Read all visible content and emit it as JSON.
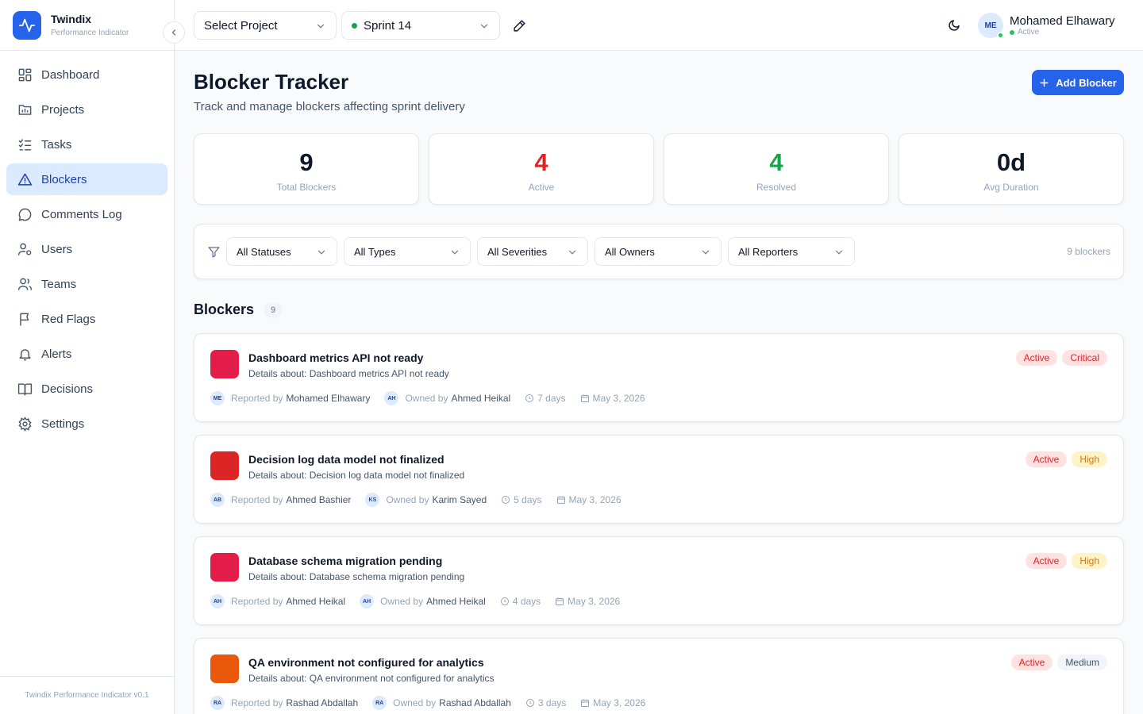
{
  "brand": {
    "name": "Twindix",
    "subtitle": "Performance Indicator"
  },
  "sidebar": {
    "items": [
      {
        "label": "Dashboard",
        "icon": "dashboard-icon"
      },
      {
        "label": "Projects",
        "icon": "projects-icon"
      },
      {
        "label": "Tasks",
        "icon": "tasks-icon"
      },
      {
        "label": "Blockers",
        "icon": "alert-triangle-icon",
        "active": true
      },
      {
        "label": "Comments Log",
        "icon": "message-icon"
      },
      {
        "label": "Users",
        "icon": "user-gear-icon"
      },
      {
        "label": "Teams",
        "icon": "users-icon"
      },
      {
        "label": "Red Flags",
        "icon": "flag-icon"
      },
      {
        "label": "Alerts",
        "icon": "bell-icon"
      },
      {
        "label": "Decisions",
        "icon": "book-icon"
      },
      {
        "label": "Settings",
        "icon": "gear-icon"
      }
    ],
    "footer": "Twindix Performance Indicator v0.1"
  },
  "header": {
    "project_select": "Select Project",
    "sprint_select": "Sprint 14",
    "user": {
      "initials": "ME",
      "name": "Mohamed Elhawary",
      "status": "Active"
    }
  },
  "page": {
    "title": "Blocker Tracker",
    "subtitle": "Track and manage blockers affecting sprint delivery",
    "add_button": "Add Blocker"
  },
  "stats": [
    {
      "value": "9",
      "label": "Total Blockers",
      "color": "#0f172a"
    },
    {
      "value": "4",
      "label": "Active",
      "color": "#dc2626"
    },
    {
      "value": "4",
      "label": "Resolved",
      "color": "#16a34a"
    },
    {
      "value": "0d",
      "label": "Avg Duration",
      "color": "#0f172a"
    }
  ],
  "filters": {
    "status": "All Statuses",
    "type": "All Types",
    "severity": "All Severities",
    "owner": "All Owners",
    "reporter": "All Reporters",
    "count": "9 blockers"
  },
  "section": {
    "title": "Blockers",
    "count": "9"
  },
  "blockers": [
    {
      "title": "Dashboard metrics API not ready",
      "description": "Details about: Dashboard metrics API not ready",
      "status": "Active",
      "severity": "Critical",
      "color": "#e11d48",
      "reporter_initials": "ME",
      "reporter_prefix": "Reported by",
      "reporter": "Mohamed Elhawary",
      "owner_initials": "AH",
      "owner_prefix": "Owned by",
      "owner": "Ahmed Heikal",
      "duration": "7 days",
      "date": "May 3, 2026"
    },
    {
      "title": "Decision log data model not finalized",
      "description": "Details about: Decision log data model not finalized",
      "status": "Active",
      "severity": "High",
      "color": "#dc2626",
      "reporter_initials": "AB",
      "reporter_prefix": "Reported by",
      "reporter": "Ahmed Bashier",
      "owner_initials": "KS",
      "owner_prefix": "Owned by",
      "owner": "Karim Sayed",
      "duration": "5 days",
      "date": "May 3, 2026"
    },
    {
      "title": "Database schema migration pending",
      "description": "Details about: Database schema migration pending",
      "status": "Active",
      "severity": "High",
      "color": "#e11d48",
      "reporter_initials": "AH",
      "reporter_prefix": "Reported by",
      "reporter": "Ahmed Heikal",
      "owner_initials": "AH",
      "owner_prefix": "Owned by",
      "owner": "Ahmed Heikal",
      "duration": "4 days",
      "date": "May 3, 2026"
    },
    {
      "title": "QA environment not configured for analytics",
      "description": "Details about: QA environment not configured for analytics",
      "status": "Active",
      "severity": "Medium",
      "color": "#ea580c",
      "reporter_initials": "RA",
      "reporter_prefix": "Reported by",
      "reporter": "Rashad Abdallah",
      "owner_initials": "RA",
      "owner_prefix": "Owned by",
      "owner": "Rashad Abdallah",
      "duration": "3 days",
      "date": "May 3, 2026"
    }
  ],
  "colors": {
    "accent": "#2563eb",
    "active_bg": "#fee2e2",
    "active_fg": "#dc2626",
    "critical_bg": "#fee2e2",
    "critical_fg": "#dc2626",
    "high_bg": "#fef3c7",
    "high_fg": "#d97706",
    "medium_bg": "#f1f5f9",
    "medium_fg": "#475569"
  }
}
